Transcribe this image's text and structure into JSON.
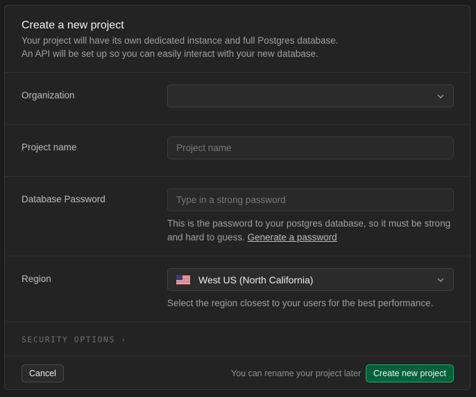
{
  "dialog": {
    "title": "Create a new project",
    "subtitle_line1": "Your project will have its own dedicated instance and full Postgres database.",
    "subtitle_line2": "An API will be set up so you can easily interact with your new database."
  },
  "organization": {
    "label": "Organization",
    "value": ""
  },
  "project_name": {
    "label": "Project name",
    "placeholder": "Project name",
    "value": ""
  },
  "database_password": {
    "label": "Database Password",
    "placeholder": "Type in a strong password",
    "value": "",
    "help_text": "This is the password to your postgres database, so it must be strong and hard to guess.",
    "generate_link": "Generate a password"
  },
  "region": {
    "label": "Region",
    "value": "West US (North California)",
    "icon": "us-flag-icon",
    "help_text": "Select the region closest to your users for the best performance."
  },
  "security_options": {
    "label": "SECURITY OPTIONS",
    "chevron": "›"
  },
  "footer": {
    "cancel_label": "Cancel",
    "note": "You can rename your project later",
    "create_label": "Create new project"
  },
  "colors": {
    "primary_button": "#006239",
    "primary_border": "#2fa56b"
  }
}
